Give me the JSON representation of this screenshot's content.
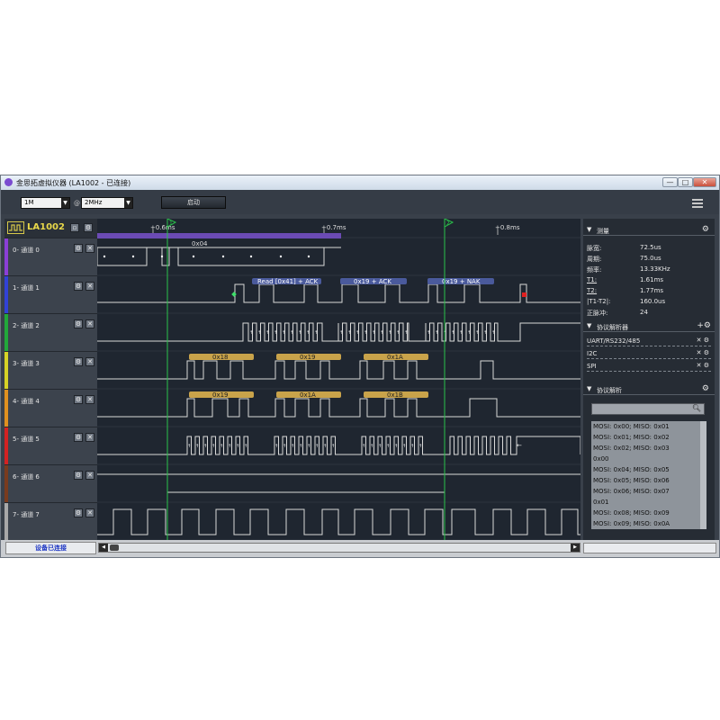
{
  "window": {
    "title": "金思拓虚拟仪器 (LA1002 - 已连接)",
    "controls": {
      "minimize": "—",
      "maximize": "□",
      "close": "✕"
    }
  },
  "toolbar": {
    "depth_value": "1M",
    "at_symbol": "@",
    "rate_value": "2MHz",
    "start_label": "启动",
    "menu_icon": "hamburger-icon"
  },
  "device": {
    "name": "LA1002"
  },
  "channels": [
    {
      "label": "0- 通道 0",
      "color": "#8b3fd6"
    },
    {
      "label": "1- 通道 1",
      "color": "#3142d6"
    },
    {
      "label": "2- 通道 2",
      "color": "#22a83a"
    },
    {
      "label": "3- 通道 3",
      "color": "#d7d326"
    },
    {
      "label": "4- 通道 4",
      "color": "#e0901f"
    },
    {
      "label": "5- 通道 5",
      "color": "#d42222"
    },
    {
      "label": "6- 通道 6",
      "color": "#7a3b1e"
    },
    {
      "label": "7- 通道 7",
      "color": "#a8a8a8"
    }
  ],
  "timeline": {
    "ticks": [
      "+0.6ms",
      "+0.7ms",
      "+0.8ms"
    ],
    "cursor1": "1",
    "cursor2": "2"
  },
  "annotations": {
    "ch0_bus": "0x04",
    "ch1": [
      "Read [0x41] + ACK",
      "0x19 + ACK",
      "0x19 + NAK"
    ],
    "ch3": [
      "0x18",
      "0x19",
      "0x1A"
    ],
    "ch4": [
      "0x19",
      "0x1A",
      "0x1B"
    ]
  },
  "measure": {
    "title": "测量",
    "rows": [
      {
        "label": "脉宽:",
        "value": "72.5us"
      },
      {
        "label": "周期:",
        "value": "75.0us"
      },
      {
        "label": "频率:",
        "value": "13.33KHz"
      },
      {
        "label": "T1:",
        "value": "1.61ms"
      },
      {
        "label": "T2:",
        "value": "1.77ms"
      },
      {
        "label": "|T1-T2|:",
        "value": "160.0us"
      },
      {
        "label": "正脉冲:",
        "value": "24"
      }
    ]
  },
  "analyzers": {
    "title": "协议解析器",
    "items": [
      "UART/RS232/485",
      "I2C",
      "SPI"
    ]
  },
  "decode": {
    "title": "协议解析",
    "search_placeholder": "",
    "lines": [
      "MOSI: 0x00;  MISO: 0x01",
      "MOSI: 0x01;  MISO: 0x02",
      "MOSI: 0x02;  MISO: 0x03",
      "0x00",
      "MOSI: 0x04;  MISO: 0x05",
      "MOSI: 0x05;  MISO: 0x06",
      "MOSI: 0x06;  MISO: 0x07",
      "0x01",
      "MOSI: 0x08;  MISO: 0x09",
      "MOSI: 0x09;  MISO: 0x0A"
    ]
  },
  "status": {
    "device": "设备已连接"
  }
}
